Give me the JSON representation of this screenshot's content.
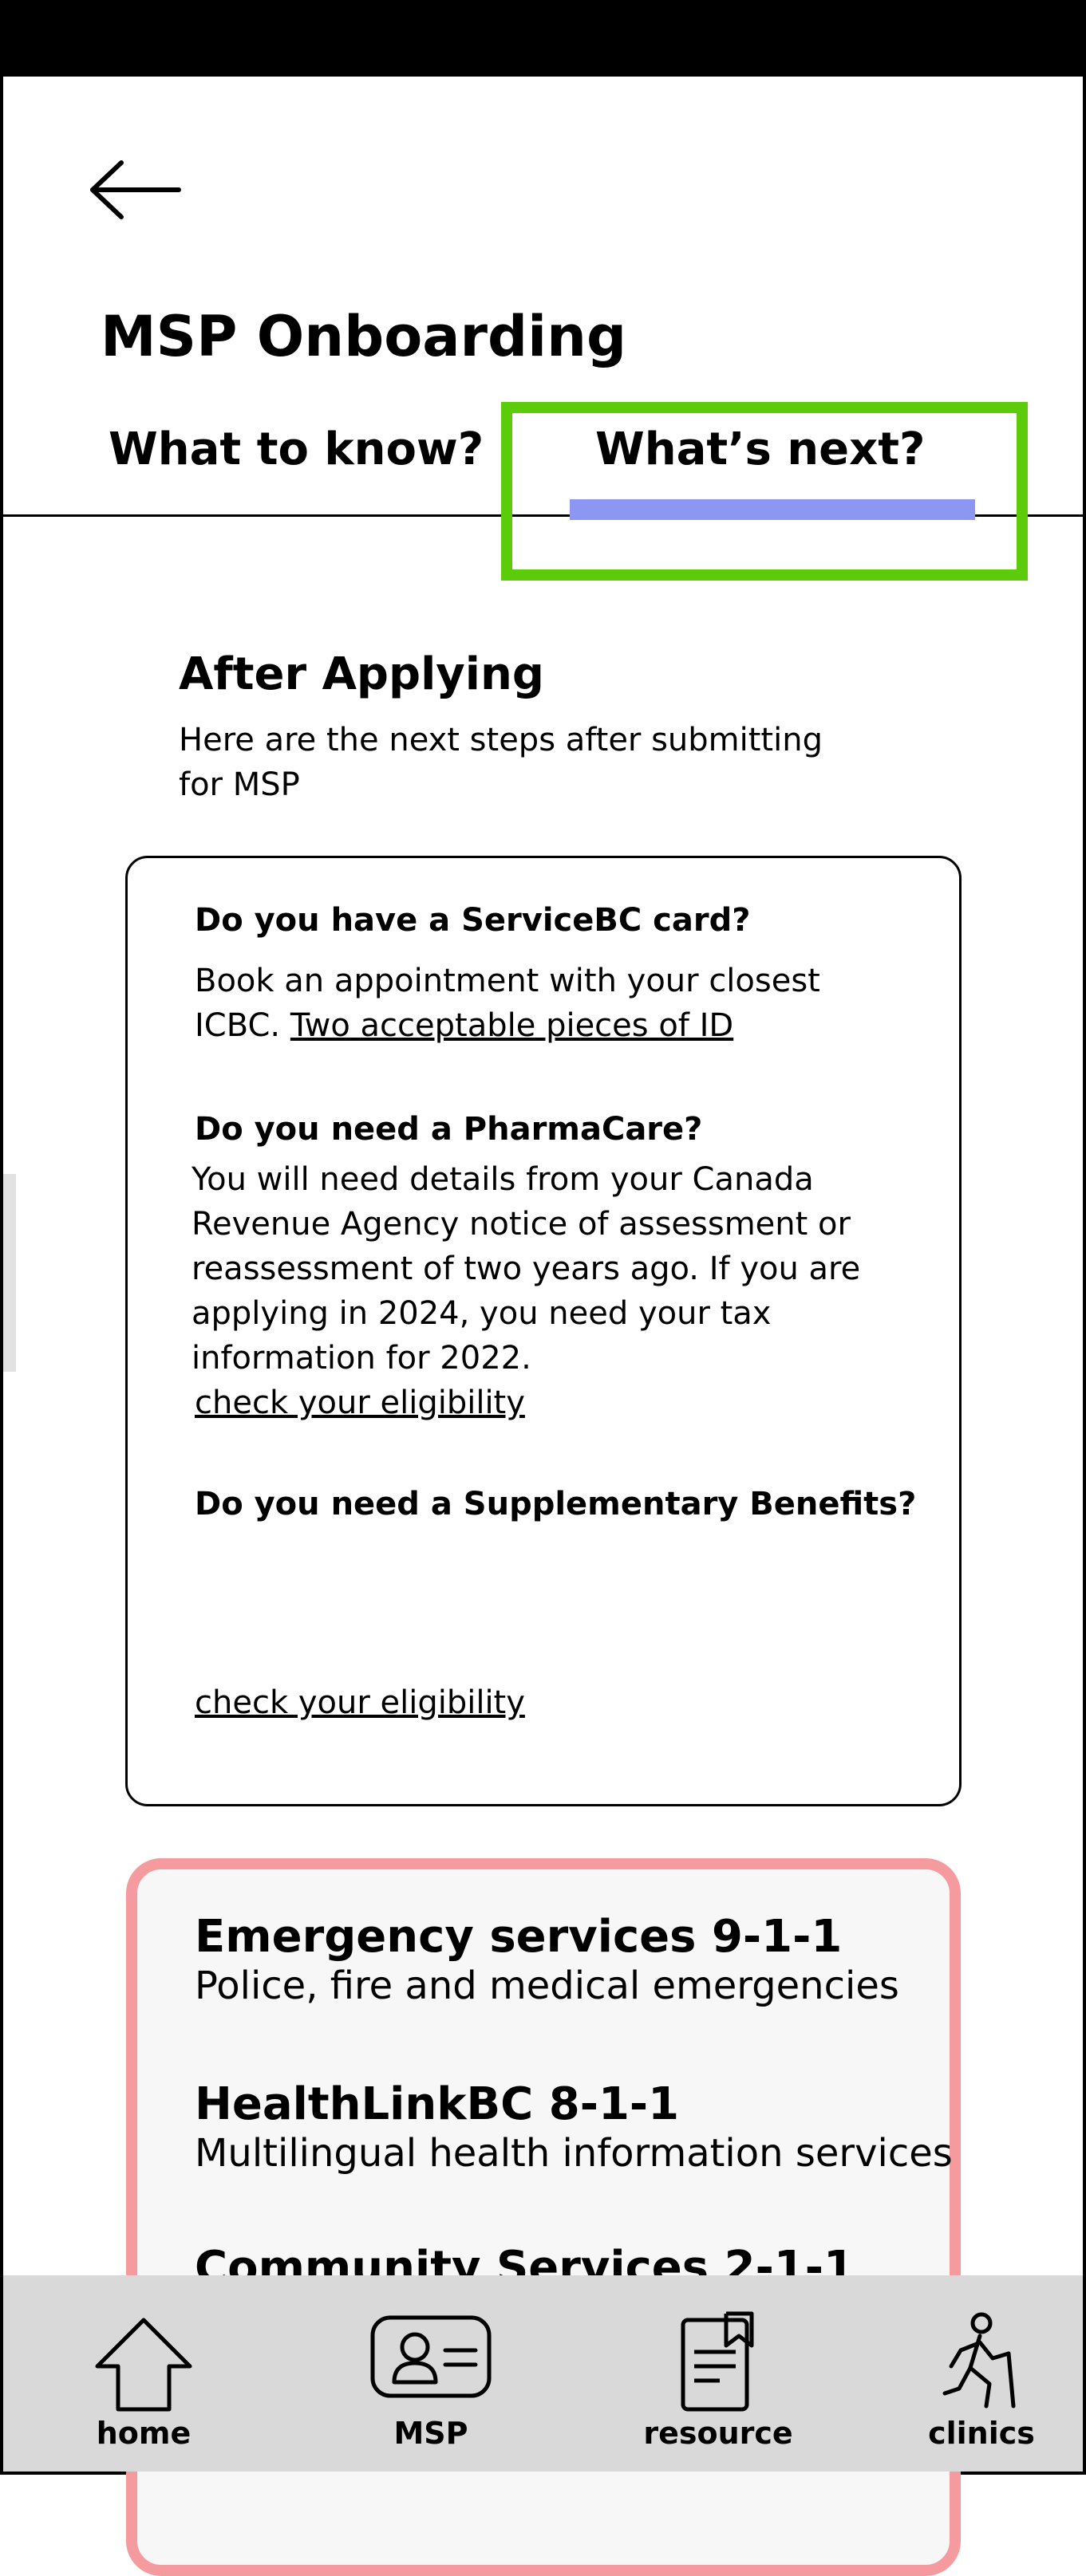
{
  "header": {
    "title": "MSP Onboarding"
  },
  "tabs": [
    {
      "label": "What to know?",
      "active": false
    },
    {
      "label": "What’s next?",
      "active": true
    }
  ],
  "section": {
    "title": "After Applying",
    "description": "Here are the next steps after submitting for MSP"
  },
  "steps": {
    "servicebc": {
      "question": "Do you have a ServiceBC card?",
      "answer_prefix": "Book an appointment with your closest ICBC. ",
      "link": "Two acceptable pieces of ID"
    },
    "pharmacare": {
      "question": "Do you need a PharmaCare?",
      "answer": "You will need details from your Canada Revenue Agency notice of assessment or reassessment of two years ago. If you are applying in 2024, you need your tax information for 2022.",
      "link": "check your eligibility"
    },
    "supplementary": {
      "question": "Do you need a Supplementary Benefits?",
      "link": "check your eligibility"
    }
  },
  "emergency": {
    "services": [
      {
        "name": "Emergency services 9-1-1",
        "description": "Police, fire and medical emergencies"
      },
      {
        "name": "HealthLinkBC 8-1-1",
        "description": "Multilingual health information services"
      },
      {
        "name": "Community Services 2-1-1",
        "description": ""
      }
    ]
  },
  "bottom_nav": [
    {
      "label": "home",
      "icon": "home-icon"
    },
    {
      "label": "MSP",
      "icon": "id-card-icon"
    },
    {
      "label": "resource",
      "icon": "document-icon"
    },
    {
      "label": "clinics",
      "icon": "walking-person-icon"
    }
  ],
  "colors": {
    "tab_indicator": "#8c97f2",
    "tab_highlight": "#5ccc0a",
    "emergency_border": "#f59a9e",
    "nav_background": "#d9d9d9"
  }
}
